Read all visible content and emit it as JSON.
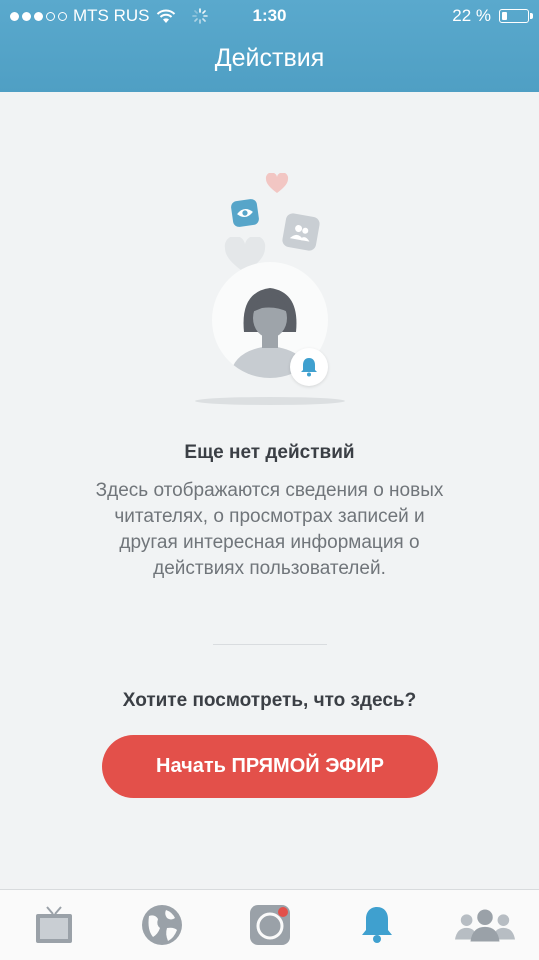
{
  "status_bar": {
    "carrier": "MTS RUS",
    "time": "1:30",
    "battery_text": "22 %",
    "battery_level": 0.22
  },
  "nav": {
    "title": "Действия"
  },
  "empty_state": {
    "title": "Еще нет действий",
    "description": "Здесь отображаются сведения о новых читателях, о просмотрах записей и другая интересная информация о действиях пользователей.",
    "question": "Хотите посмотреть, что здесь?",
    "cta_label": "Начать ПРЯМОЙ ЭФИР"
  },
  "tabs": [
    {
      "name": "tv-icon",
      "active": false
    },
    {
      "name": "globe-icon",
      "active": false
    },
    {
      "name": "camera-icon",
      "active": false
    },
    {
      "name": "bell-icon",
      "active": true
    },
    {
      "name": "people-icon",
      "active": false
    }
  ],
  "colors": {
    "header": "#57a5c9",
    "accent": "#3fa0cf",
    "cta": "#e3504a",
    "inactive_icon": "#9aa1a8"
  }
}
